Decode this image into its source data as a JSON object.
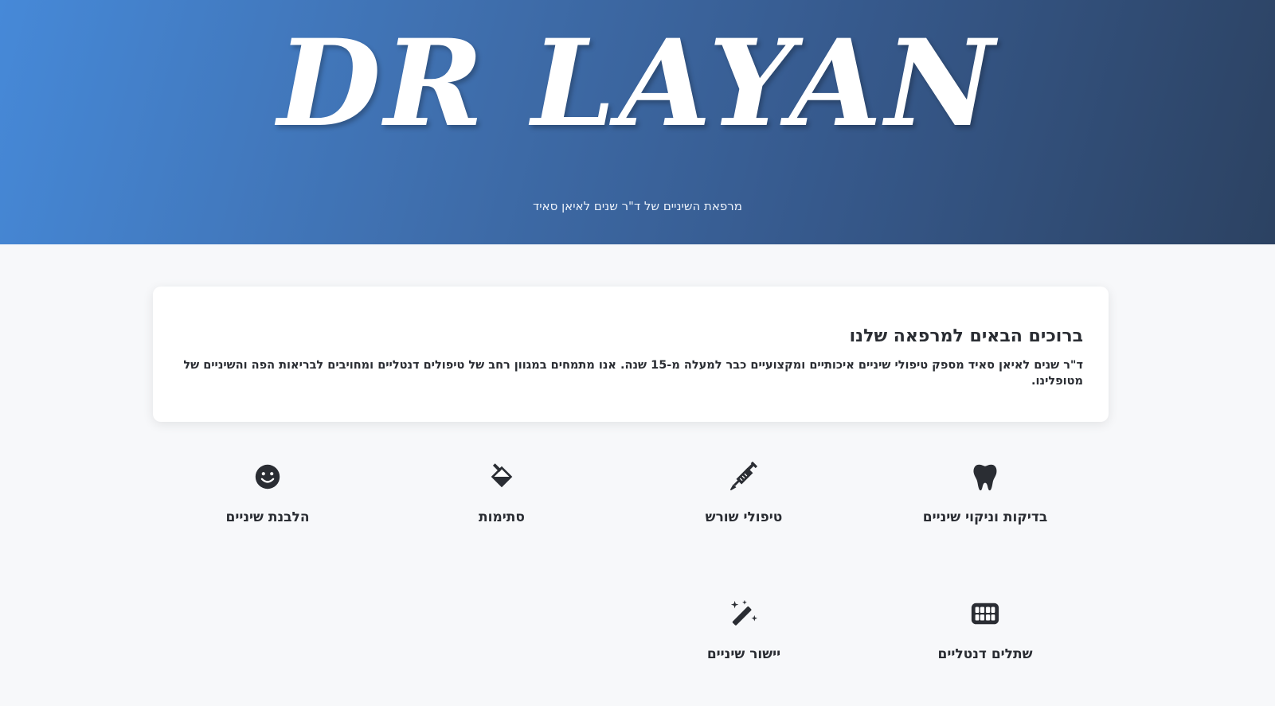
{
  "hero": {
    "brand": "DR LAYAN",
    "tagline": "מרפאת השיניים של ד\"ר שנים לאיאן סאיד",
    "gradient_colors": [
      "#4689d8",
      "#2c4262"
    ]
  },
  "welcome": {
    "title": "ברוכים הבאים למרפאה שלנו",
    "text": "ד\"ר שנים לאיאן סאיד מספק טיפולי שיניים איכותיים ומקצועיים כבר למעלה מ-15 שנה. אנו מתמחים במגוון רחב של טיפולים דנטליים ומחויבים לבריאות הפה והשיניים של מטופלינו."
  },
  "services": [
    {
      "label": "בדיקות וניקוי שיניים",
      "icon": "tooth-icon"
    },
    {
      "label": "טיפולי שורש",
      "icon": "syringe-icon"
    },
    {
      "label": "סתימות",
      "icon": "fill-drip-icon"
    },
    {
      "label": "הלבנת שיניים",
      "icon": "smile-icon"
    },
    {
      "label": "שתלים דנטליים",
      "icon": "teeth-icon"
    },
    {
      "label": "יישור שיניים",
      "icon": "magic-wand-icon"
    }
  ],
  "colors": {
    "text": "#2a2d33",
    "background": "#f7f8fa",
    "card": "#ffffff"
  }
}
